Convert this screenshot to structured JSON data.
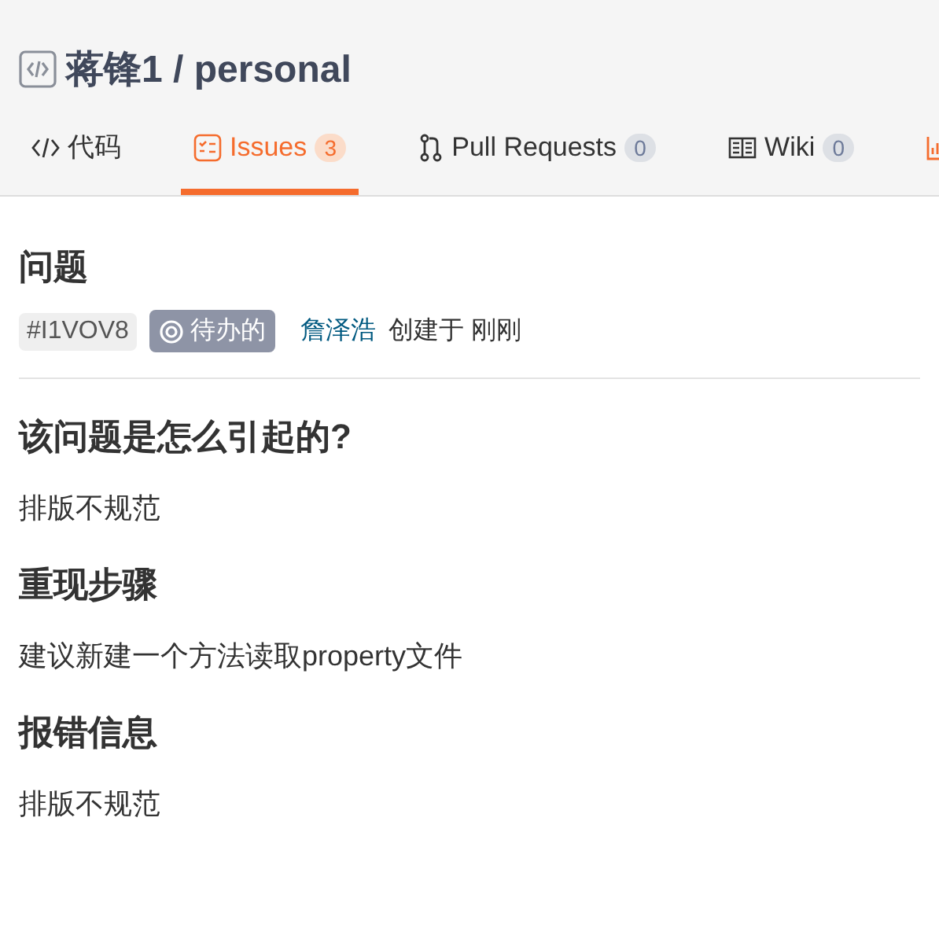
{
  "repo": {
    "title": "蒋锋1 / personal"
  },
  "tabs": [
    {
      "kind": "code",
      "label": "代码",
      "selected": false
    },
    {
      "kind": "issues",
      "label": "Issues",
      "count": "3",
      "selected": true
    },
    {
      "kind": "pr",
      "label": "Pull Requests",
      "count": "0",
      "selected": false
    },
    {
      "kind": "wiki",
      "label": "Wiki",
      "count": "0",
      "selected": false
    },
    {
      "kind": "stats",
      "selected": false
    }
  ],
  "issue": {
    "heading": "问题",
    "id": "#I1VOV8",
    "status": "待办的",
    "author": "詹泽浩",
    "created": "创建于 刚刚"
  },
  "sections": [
    {
      "heading": "该问题是怎么引起的?",
      "body": "排版不规范"
    },
    {
      "heading": "重现步骤",
      "body": "建议新建一个方法读取property文件"
    },
    {
      "heading": "报错信息",
      "body": "排版不规范"
    }
  ]
}
